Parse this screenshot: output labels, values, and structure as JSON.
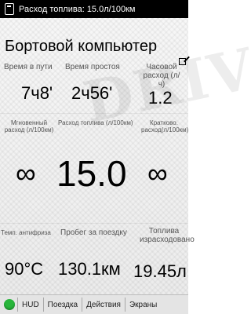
{
  "status_bar": {
    "text": "Расход топлива: 15.0л/100км"
  },
  "title": "Бортовой компьютер",
  "row1": {
    "travel_time": {
      "label": "Время в пути",
      "value": "7ч8'"
    },
    "idle_time": {
      "label": "Время простоя",
      "value": "2ч56'"
    },
    "hourly_consumption": {
      "label": "Часовой расход (л/ч)",
      "value": "1.2"
    }
  },
  "row2": {
    "instant_label": "Мгновенный расход (л/100км)",
    "consumption_label": "Расход топлива (л/100км)",
    "short_label": "Кратково. расход(л/100км)",
    "left_value": "∞",
    "main_value": "15.0",
    "right_value": "∞"
  },
  "row3": {
    "antifreeze": {
      "label": "Темп. антифриза",
      "value": "90°C"
    },
    "trip_distance": {
      "label": "Пробег за поездку",
      "value": "130.1км"
    },
    "fuel_used": {
      "label": "Топлива израсходовано",
      "value": "19.45л"
    }
  },
  "nav": {
    "items": [
      "HUD",
      "Поездка",
      "Действия",
      "Экраны"
    ],
    "status_color": "#27b53a"
  }
}
